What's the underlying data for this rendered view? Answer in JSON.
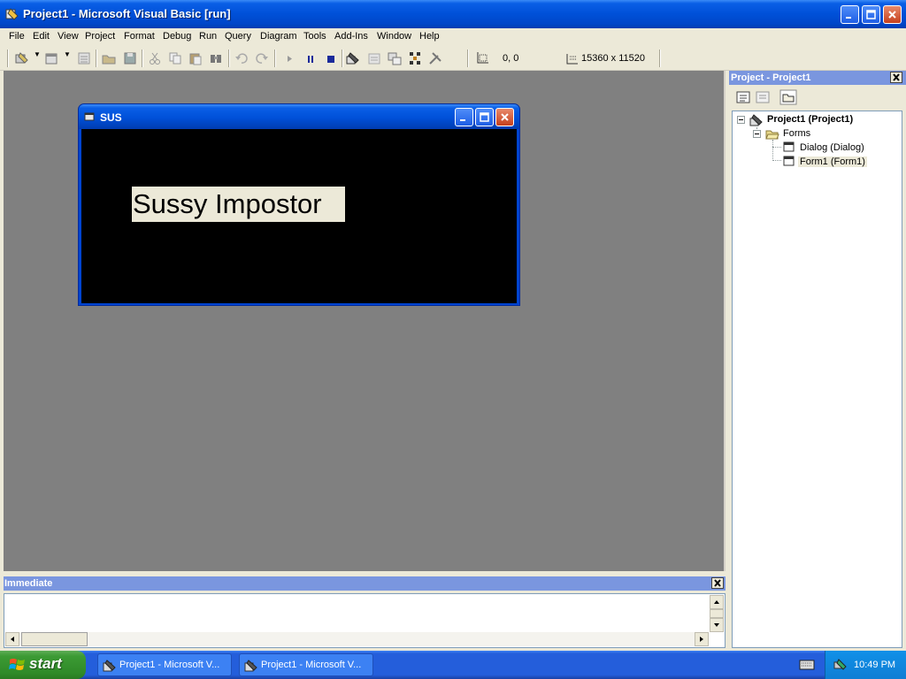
{
  "window": {
    "title": "Project1 - Microsoft Visual Basic [run]"
  },
  "menu": [
    "File",
    "Edit",
    "View",
    "Project",
    "Format",
    "Debug",
    "Run",
    "Query",
    "Diagram",
    "Tools",
    "Add-Ins",
    "Window",
    "Help"
  ],
  "toolbar": {
    "position": "0, 0",
    "size": "15360 x 11520"
  },
  "form": {
    "title": "SUS",
    "label_text": "Sussy Impostor"
  },
  "project_explorer": {
    "title": "Project - Project1",
    "tree": {
      "project": "Project1 (Project1)",
      "folder": "Forms",
      "items": [
        "Dialog (Dialog)",
        "Form1 (Form1)"
      ]
    }
  },
  "immediate": {
    "title": "Immediate"
  },
  "taskbar": {
    "start_label": "start",
    "tasks": [
      "Project1 - Microsoft V...",
      "Project1 - Microsoft V..."
    ],
    "clock": "10:49 PM"
  },
  "colors": {
    "titlebar": "#0050d8",
    "mdi_background": "#808080",
    "form_body": "#000000",
    "panel_header": "#7a96df",
    "start_button": "#3c9a34"
  }
}
